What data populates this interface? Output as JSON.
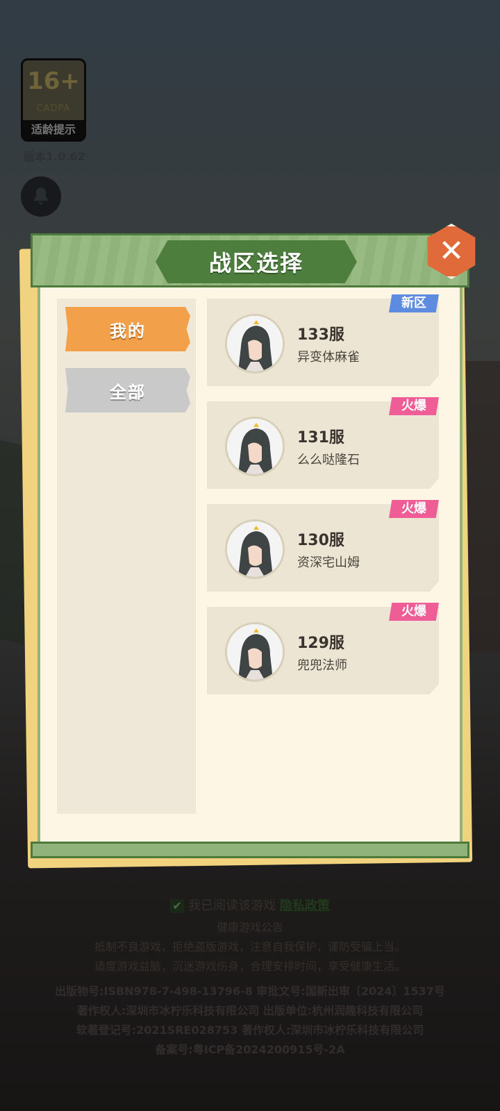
{
  "age_badge": {
    "rating": "16+",
    "org": "CADPA",
    "tip": "适龄提示"
  },
  "version": "版本1.0.62",
  "modal": {
    "title": "战区选择",
    "tabs": [
      {
        "label": "我的",
        "active": true
      },
      {
        "label": "全部",
        "active": false
      }
    ],
    "servers": [
      {
        "name": "133服",
        "player": "异变体麻雀",
        "tag": "新区"
      },
      {
        "name": "131服",
        "player": "么么哒隆石",
        "tag": "火爆"
      },
      {
        "name": "130服",
        "player": "资深宅山姆",
        "tag": "火爆"
      },
      {
        "name": "129服",
        "player": "兜兜法师",
        "tag": "火爆"
      }
    ]
  },
  "agreement": {
    "text": "我已阅读该游戏",
    "link": "隐私政策"
  },
  "health": {
    "title": "健康游戏公告",
    "line1": "抵制不良游戏，拒绝盗版游戏，注意自我保护，谨防受骗上当。",
    "line2": "适度游戏益脑，沉迷游戏伤身，合理安排时间，享受健康生活。"
  },
  "publication": [
    "出版物号:ISBN978-7-498-13796-8 审批文号:国新出审〔2024〕1537号",
    "著作权人:深圳市冰柠乐科技有限公司 出版单位:杭州润趣科技有限公司",
    "软著登记号:2021SRE028753 著作权人:深圳市冰柠乐科技有限公司",
    "备案号:粤ICP备2024200915号-2A"
  ],
  "colors": {
    "header_green": "#4e7e3e",
    "tab_active": "#f2a04a",
    "tab_inactive": "#c9c9c9",
    "badge_new": "#5d8be0",
    "badge_hot": "#ee5d95",
    "close": "#e06a3a"
  }
}
